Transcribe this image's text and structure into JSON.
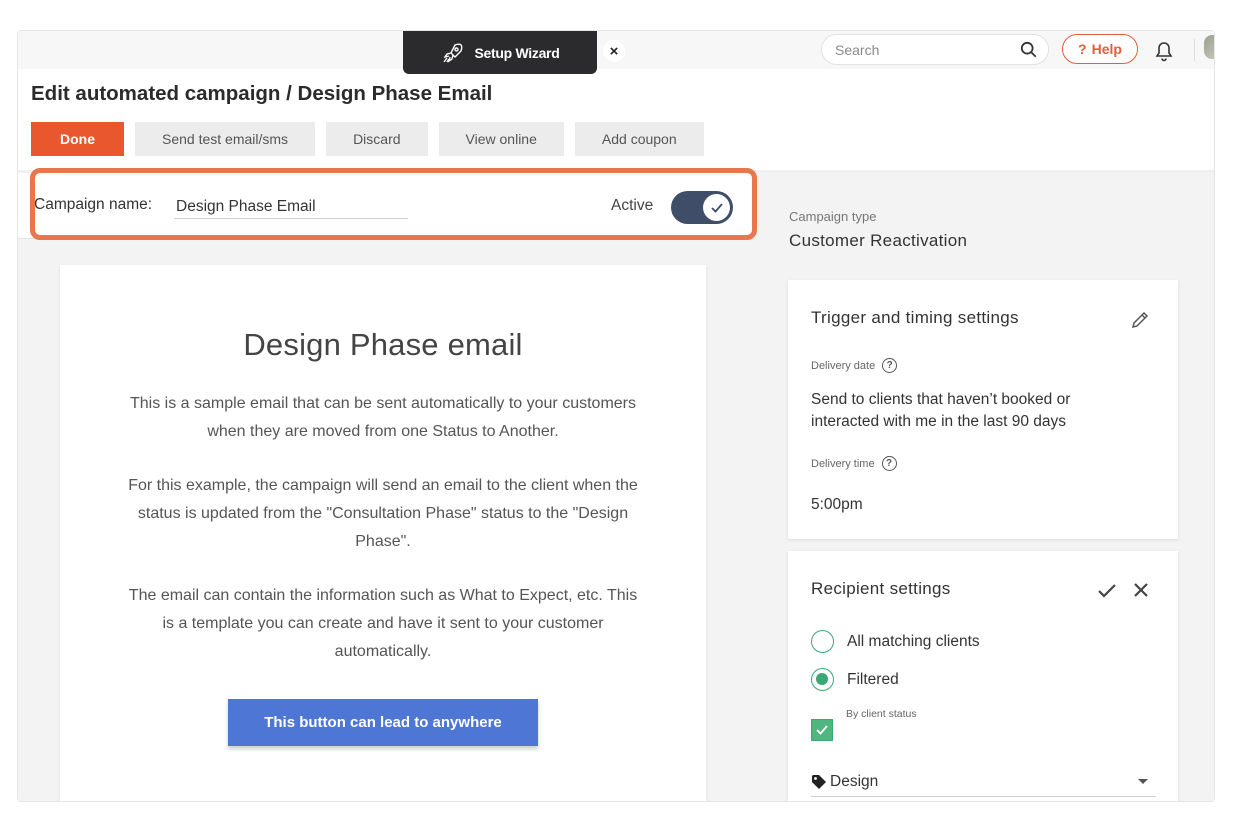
{
  "topbar": {
    "wizard_label": "Setup Wizard",
    "wizard_close": "×",
    "search_placeholder": "Search",
    "help_label": "Help",
    "help_icon": "?"
  },
  "header": {
    "title": "Edit automated campaign / Design Phase Email",
    "buttons": {
      "done": "Done",
      "send_test": "Send test email/sms",
      "discard": "Discard",
      "view_online": "View online",
      "add_coupon": "Add coupon"
    }
  },
  "campaign": {
    "name_label": "Campaign name:",
    "name_value": "Design Phase Email",
    "active_label": "Active",
    "active": true
  },
  "email": {
    "heading": "Design Phase email",
    "paragraphs": [
      "This is a sample email that can be sent automatically to your customers when they are moved from one Status to Another.",
      "For this example, the campaign will send an email to the client when the status is updated from the \"Consultation Phase\" status to the \"Design Phase\".",
      "The email can contain the information such as What to Expect, etc. This is a template you can create and have it sent to your customer automatically."
    ],
    "button_label": "This button can lead to anywhere"
  },
  "sidebar": {
    "campaign_type_label": "Campaign type",
    "campaign_type_value": "Customer Reactivation",
    "trigger": {
      "title": "Trigger and timing settings",
      "delivery_date_label": "Delivery date",
      "delivery_date_value": "Send to clients that haven’t booked or interacted with me in the last 90 days",
      "delivery_time_label": "Delivery time",
      "delivery_time_value": "5:00pm"
    },
    "recipients": {
      "title": "Recipient settings",
      "option_all": "All matching clients",
      "option_filtered": "Filtered",
      "selected": "Filtered",
      "by_status_label": "By client status",
      "status_value": "Design"
    }
  },
  "colors": {
    "accent": "#e9572f",
    "highlight": "#e8774f",
    "toggle": "#3f4d69",
    "cta": "#4e76d4",
    "success": "#3aa873"
  }
}
